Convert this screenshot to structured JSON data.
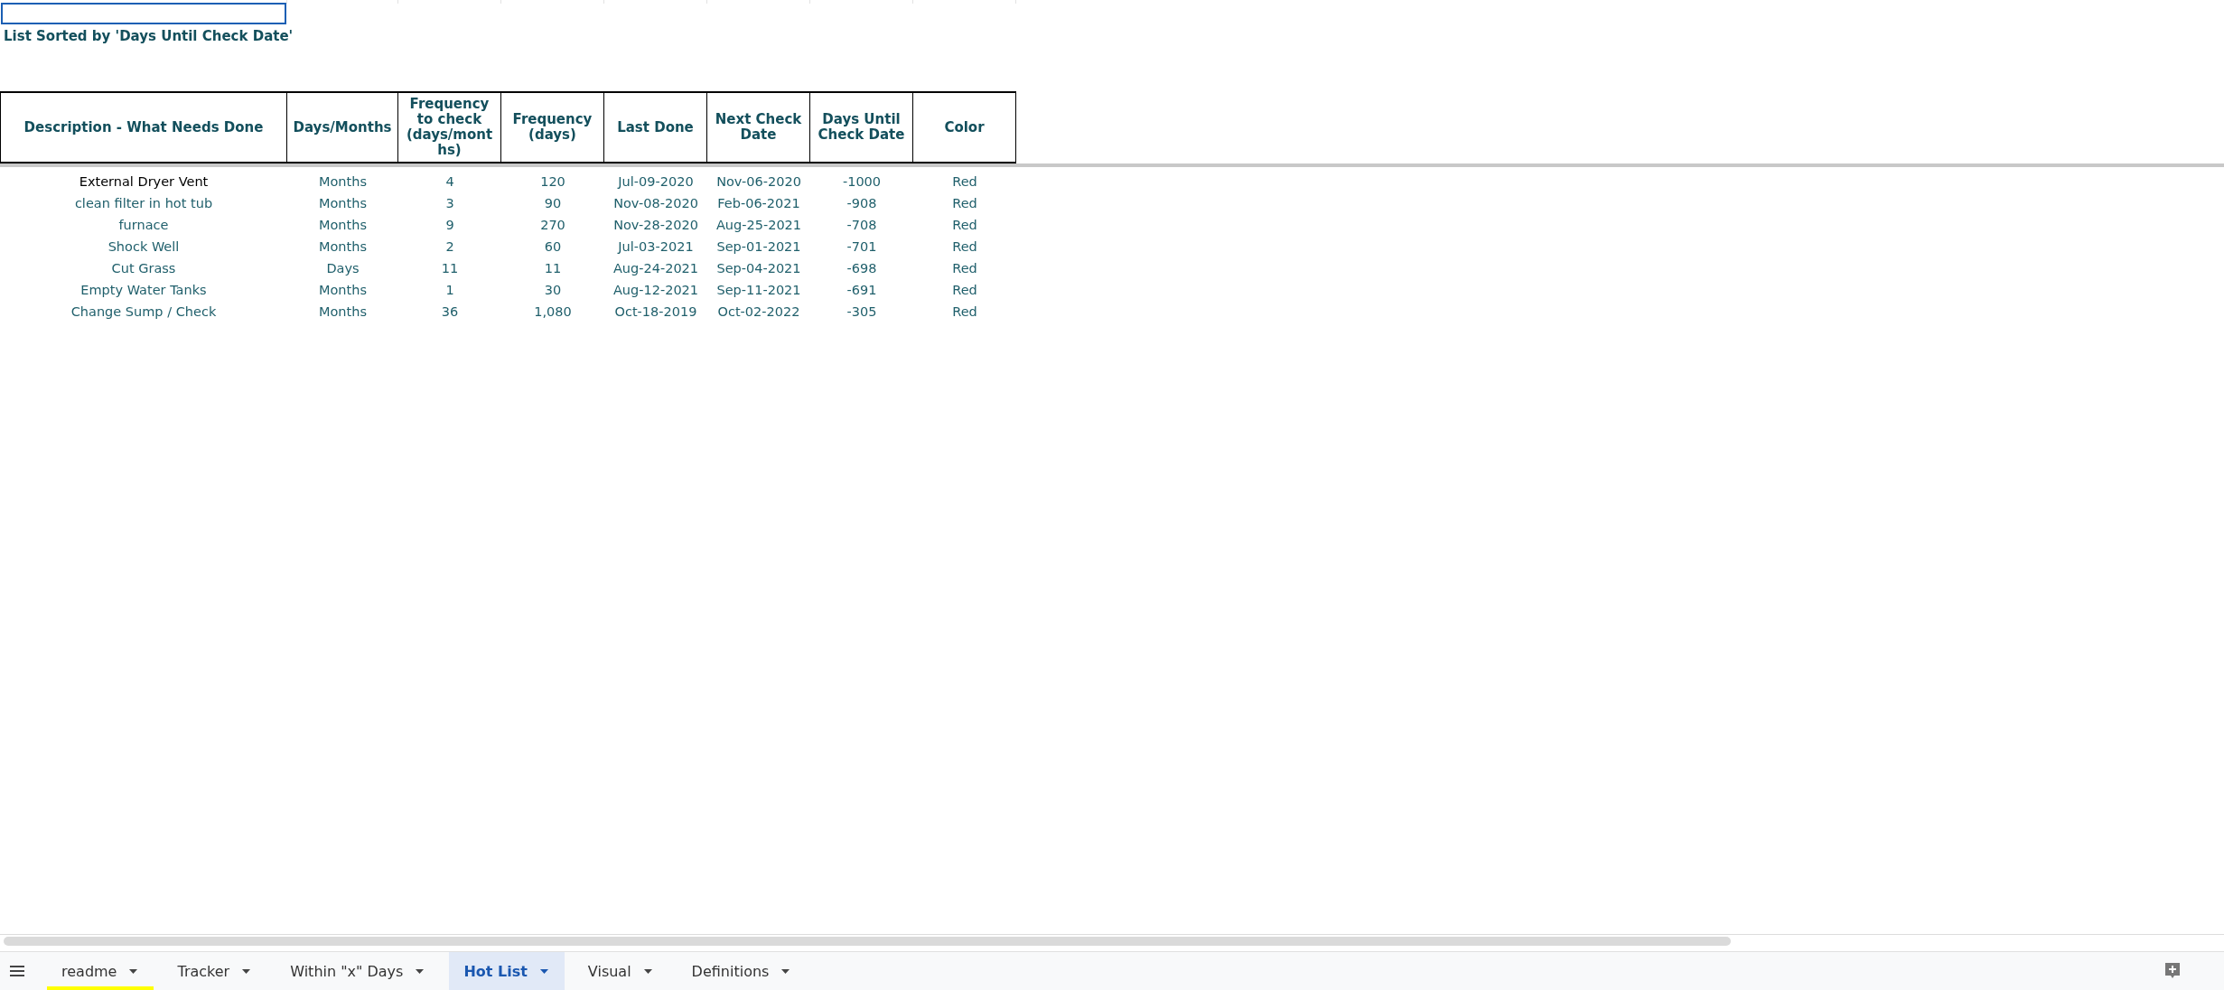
{
  "sheet": {
    "title": "List Sorted by 'Days Until Check Date'",
    "columns": [
      "Description - What Needs Done",
      "Days/Months",
      "Frequency to check (days/mont hs)",
      "Frequency (days)",
      "Last Done",
      "Next Check Date",
      "Days Until Check Date",
      "Color"
    ],
    "rows": [
      {
        "cells": [
          "External Dryer Vent",
          "Months",
          "4",
          "120",
          "Jul-09-2020",
          "Nov-06-2020",
          "-1000",
          "Red"
        ],
        "color": "#000000"
      },
      {
        "cells": [
          "clean filter in hot tub",
          "Months",
          "3",
          "90",
          "Nov-08-2020",
          "Feb-06-2021",
          "-908",
          "Red"
        ],
        "color": "#1f5f6b"
      },
      {
        "cells": [
          "furnace",
          "Months",
          "9",
          "270",
          "Nov-28-2020",
          "Aug-25-2021",
          "-708",
          "Red"
        ],
        "color": "#1f5f6b"
      },
      {
        "cells": [
          "Shock Well",
          "Months",
          "2",
          "60",
          "Jul-03-2021",
          "Sep-01-2021",
          "-701",
          "Red"
        ],
        "color": "#1f5f6b"
      },
      {
        "cells": [
          "Cut Grass",
          "Days",
          "11",
          "11",
          "Aug-24-2021",
          "Sep-04-2021",
          "-698",
          "Red"
        ],
        "color": "#1f5f6b"
      },
      {
        "cells": [
          "Empty Water Tanks",
          "Months",
          "1",
          "30",
          "Aug-12-2021",
          "Sep-11-2021",
          "-691",
          "Red"
        ],
        "color": "#1f5f6b"
      },
      {
        "cells": [
          "Change Sump / Check",
          "Months",
          "36",
          "1,080",
          "Oct-18-2019",
          "Oct-02-2022",
          "-305",
          "Red"
        ],
        "color": "#1f5f6b"
      }
    ]
  },
  "tabs": [
    {
      "label": "readme",
      "selected": false,
      "color": "#ffff00"
    },
    {
      "label": "Tracker",
      "selected": false
    },
    {
      "label": "Within \"x\" Days",
      "selected": false
    },
    {
      "label": "Hot List",
      "selected": true
    },
    {
      "label": "Visual",
      "selected": false
    },
    {
      "label": "Definitions",
      "selected": false
    }
  ]
}
